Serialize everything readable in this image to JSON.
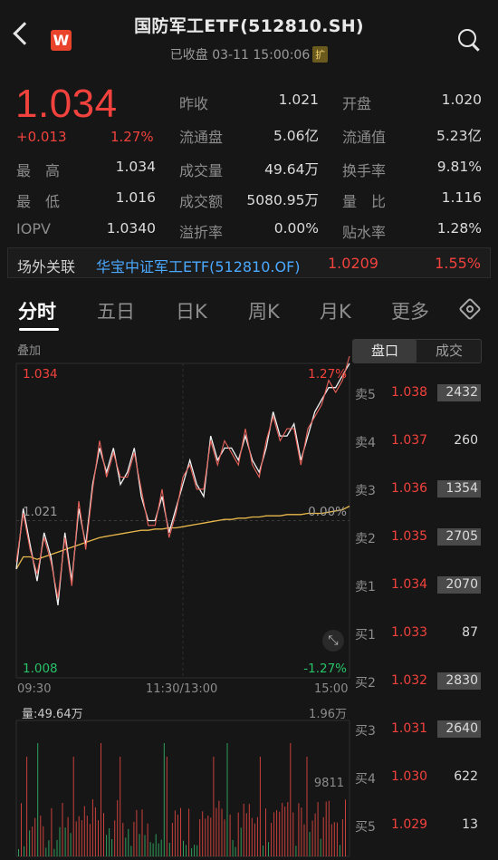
{
  "header": {
    "title": "国防军工ETF(512810.SH)",
    "status": "已收盘 03-11 15:00:06",
    "ext_badge": "扩",
    "logo_letter": "W"
  },
  "quote": {
    "price": "1.034",
    "change": "+0.013",
    "change_pct": "1.27%",
    "rows": [
      [
        {
          "l": "最　高",
          "v": "1.034"
        },
        {
          "l": "昨收",
          "v": "1.021"
        },
        {
          "l": "开盘",
          "v": "1.020"
        }
      ],
      [
        {
          "l": "最　低",
          "v": "1.016"
        },
        {
          "l": "流通盘",
          "v": "5.06亿"
        },
        {
          "l": "流通值",
          "v": "5.23亿"
        }
      ],
      [
        {
          "l": "IOPV",
          "v": "1.0340"
        },
        {
          "l": "成交量",
          "v": "49.64万"
        },
        {
          "l": "换手率",
          "v": "9.81%"
        }
      ],
      [
        {
          "l": "",
          "v": ""
        },
        {
          "l": "成交额",
          "v": "5080.95万"
        },
        {
          "l": "量　比",
          "v": "1.116"
        }
      ],
      [
        {
          "l": "",
          "v": ""
        },
        {
          "l": "溢折率",
          "v": "0.00%"
        },
        {
          "l": "贴水率",
          "v": "1.28%"
        }
      ]
    ]
  },
  "relation": {
    "label": "场外关联",
    "name": "华宝中证军工ETF(512810.OF)",
    "price": "1.0209",
    "pct": "1.55%"
  },
  "tabs": [
    "分时",
    "五日",
    "日K",
    "周K",
    "月K",
    "更多"
  ],
  "chart": {
    "overlay_label": "叠加",
    "top_price": "1.034",
    "top_pct": "1.27%",
    "mid_price": "1.021",
    "mid_pct": "0.00%",
    "bottom_price": "1.008",
    "bottom_pct": "-1.27%",
    "time_start": "09:30",
    "time_mid": "11:30/13:00",
    "time_end": "15:00",
    "vol_label": "量:49.64万",
    "vol_max": "1.96万",
    "vol_mid": "9811"
  },
  "chart_data": {
    "type": "line",
    "ylim": [
      1.008,
      1.034
    ],
    "series": [
      {
        "values": [
          1.017,
          1.022,
          1.019,
          1.016,
          1.02,
          1.018,
          1.014,
          1.02,
          1.016,
          1.022,
          1.019,
          1.024,
          1.027,
          1.025,
          1.027,
          1.024,
          1.025,
          1.027,
          1.023,
          1.021,
          1.021,
          1.023,
          1.02,
          1.022,
          1.024,
          1.026,
          1.024,
          1.023,
          1.028,
          1.026,
          1.027,
          1.027,
          1.026,
          1.028,
          1.026,
          1.025,
          1.027,
          1.03,
          1.028,
          1.028,
          1.029,
          1.026,
          1.028,
          1.03,
          1.031,
          1.032,
          1.032,
          1.033,
          1.034
        ]
      },
      {
        "values": [
          1.017,
          1.018,
          1.018,
          1.0178,
          1.018,
          1.0182,
          1.0184,
          1.0186,
          1.0188,
          1.019,
          1.0192,
          1.0194,
          1.0196,
          1.0197,
          1.0198,
          1.0199,
          1.02,
          1.0201,
          1.0202,
          1.0202,
          1.0203,
          1.0203,
          1.0204,
          1.0204,
          1.0205,
          1.0206,
          1.0207,
          1.0208,
          1.0209,
          1.021,
          1.0211,
          1.0211,
          1.0212,
          1.0212,
          1.0213,
          1.0213,
          1.0214,
          1.0214,
          1.0214,
          1.0215,
          1.0215,
          1.0215,
          1.0216,
          1.0216,
          1.0216,
          1.0217,
          1.0218,
          1.0219,
          1.0222
        ]
      }
    ],
    "volume_ylim": [
      0,
      19600
    ]
  },
  "orderbook": {
    "toggle": [
      "盘口",
      "成交"
    ],
    "rows": [
      {
        "label": "卖5",
        "price": "1.038",
        "vol": "2432",
        "bar": 0.86
      },
      {
        "label": "卖4",
        "price": "1.037",
        "vol": "260",
        "bar": 0.0
      },
      {
        "label": "卖3",
        "price": "1.036",
        "vol": "1354",
        "bar": 0.25
      },
      {
        "label": "卖2",
        "price": "1.035",
        "vol": "2705",
        "bar": 0.93
      },
      {
        "label": "卖1",
        "price": "1.034",
        "vol": "2070",
        "bar": 0.72
      },
      {
        "label": "买1",
        "price": "1.033",
        "vol": "87",
        "bar": 0.0
      },
      {
        "label": "买2",
        "price": "1.032",
        "vol": "2830",
        "bar": 1.0
      },
      {
        "label": "买3",
        "price": "1.031",
        "vol": "2640",
        "bar": 0.93
      },
      {
        "label": "买4",
        "price": "1.030",
        "vol": "622",
        "bar": 0.0
      },
      {
        "label": "买5",
        "price": "1.029",
        "vol": "13",
        "bar": 0.0
      }
    ]
  }
}
